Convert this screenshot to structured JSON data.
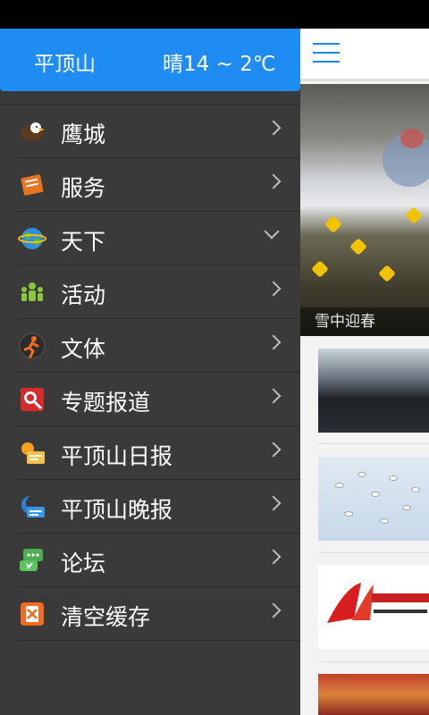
{
  "drawer": {
    "city": "平顶山",
    "weather": "晴14 ~ 2℃",
    "items": [
      {
        "label": "鹰城",
        "icon": "eagle-icon",
        "expanded": false
      },
      {
        "label": "服务",
        "icon": "book-icon",
        "expanded": false
      },
      {
        "label": "天下",
        "icon": "globe-icon",
        "expanded": true
      },
      {
        "label": "活动",
        "icon": "people-icon",
        "expanded": false
      },
      {
        "label": "文体",
        "icon": "runner-icon",
        "expanded": false
      },
      {
        "label": "专题报道",
        "icon": "magnifier-icon",
        "expanded": false
      },
      {
        "label": "平顶山日报",
        "icon": "sun-newspaper-icon",
        "expanded": false
      },
      {
        "label": "平顶山晚报",
        "icon": "moon-newspaper-icon",
        "expanded": false
      },
      {
        "label": "论坛",
        "icon": "forum-icon",
        "expanded": false
      },
      {
        "label": "清空缓存",
        "icon": "clear-cache-icon",
        "expanded": false
      }
    ]
  },
  "content": {
    "hero_caption": "雪中迎春"
  },
  "colors": {
    "header_blue": "#1e8cf2",
    "drawer_bg": "#3a3a3a"
  }
}
